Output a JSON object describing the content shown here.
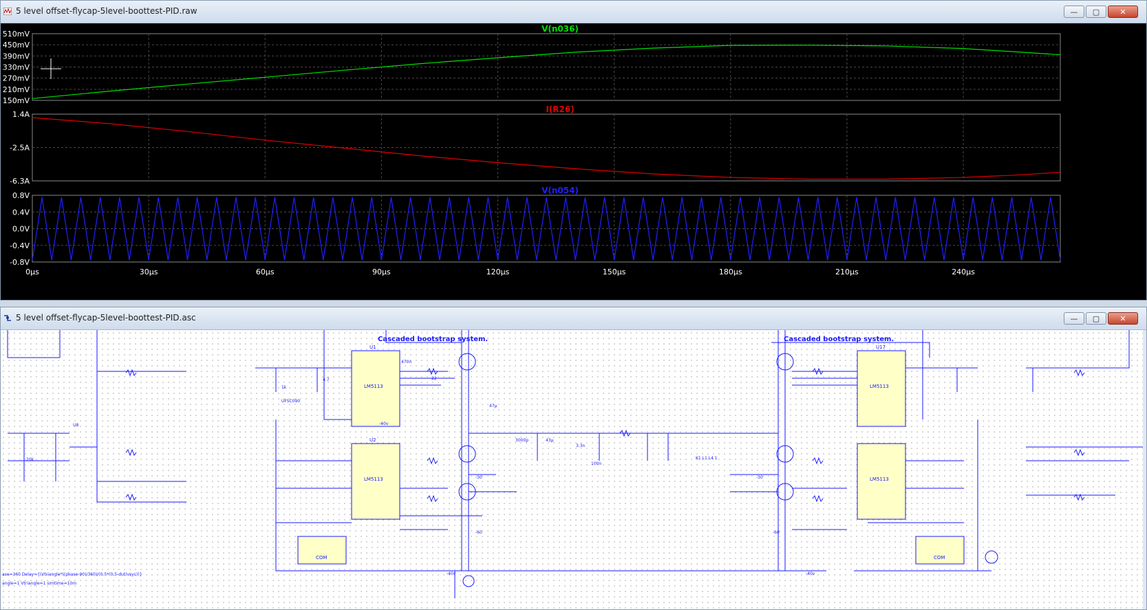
{
  "waveform_window": {
    "title": "5 level offset-flycap-5level-boottest-PID.raw",
    "buttons": {
      "minimize": "—",
      "maximize": "▢",
      "close": "✕"
    }
  },
  "schematic_window": {
    "title": "5 level offset-flycap-5level-boottest-PID.asc",
    "buttons": {
      "minimize": "—",
      "maximize": "▢",
      "close": "✕"
    }
  },
  "colors": {
    "green": "#00e000",
    "red": "#e00000",
    "blue": "#2020ff",
    "grid": "#4a4a4a",
    "wire": "#1a1aff",
    "part": "#ffffc8"
  },
  "chart_data": [
    {
      "type": "line",
      "title": "V(n036)",
      "yticks": [
        "510mV",
        "450mV",
        "390mV",
        "330mV",
        "270mV",
        "210mV",
        "150mV"
      ],
      "ylim": [
        150,
        510
      ],
      "xlim": [
        0,
        265
      ],
      "series": [
        {
          "name": "V(n036)",
          "x": [
            0,
            20,
            40,
            60,
            80,
            100,
            120,
            140,
            160,
            180,
            200,
            220,
            240,
            255,
            265
          ],
          "y": [
            160,
            200,
            238,
            275,
            312,
            348,
            380,
            410,
            432,
            447,
            448,
            444,
            430,
            410,
            396
          ]
        }
      ]
    },
    {
      "type": "line",
      "title": "I(R26)",
      "yticks": [
        "1.4A",
        "-2.5A",
        "-6.3A"
      ],
      "ylim": [
        -6.3,
        1.4
      ],
      "xlim": [
        0,
        265
      ],
      "series": [
        {
          "name": "I(R26)",
          "x": [
            0,
            20,
            40,
            60,
            80,
            100,
            120,
            140,
            160,
            180,
            200,
            220,
            240,
            255,
            265
          ],
          "y": [
            1.0,
            0.3,
            -0.6,
            -1.6,
            -2.5,
            -3.4,
            -4.2,
            -4.9,
            -5.5,
            -5.9,
            -6.1,
            -6.1,
            -5.9,
            -5.6,
            -5.3
          ]
        }
      ]
    },
    {
      "type": "line",
      "title": "V(n054)",
      "yticks": [
        "0.8V",
        "0.4V",
        "0.0V",
        "-0.4V",
        "-0.8V"
      ],
      "ylim": [
        -0.85,
        0.85
      ],
      "xlim": [
        0,
        265
      ],
      "series": [
        {
          "name": "V(n054)",
          "period": 5,
          "amplitude": 0.8
        }
      ],
      "xticks": [
        "0µs",
        "30µs",
        "60µs",
        "90µs",
        "120µs",
        "150µs",
        "180µs",
        "210µs",
        "240µs"
      ]
    }
  ],
  "schematic": {
    "labels": {
      "cascade_left": "Cascaded bootstrap system.",
      "cascade_right": "Cascaded bootstrap system.",
      "ic_left_top": "LM5113",
      "ic_left_bot": "LM5113",
      "ic_right_top": "LM5113",
      "ic_right_bot": "LM5113",
      "u1": "U1",
      "u2": "U2",
      "u17": "U17",
      "u8": "U8",
      "com_left": "COM",
      "com_right": "COM",
      "k_label": "K1 L1 L4 1",
      "neg40_a": "-40v",
      "neg40_b": "-40v",
      "neg40_c": "-40v",
      "neg30_a": "-30",
      "neg30_b": "-30",
      "neg60_a": "-60",
      "neg60_b": "-60",
      "param1": "ase=360 Delay={(Vtriangle*((phase-90)/360)/(0.5*(0.5-dut)vsyc))}",
      "param2": "angle=1 Vtriangle=1 simtime=10m",
      "val_470n": "470n",
      "val_22": "22",
      "val_47u": "47µ",
      "val_3000p": "3000p",
      "val_43u": "43µ",
      "val_3_3n": "3.3n",
      "val_100n": "100n",
      "val_20k": "20k",
      "val_1k": "1k",
      "val_4_7": "4.7",
      "val_uf": "UFSC090"
    }
  }
}
